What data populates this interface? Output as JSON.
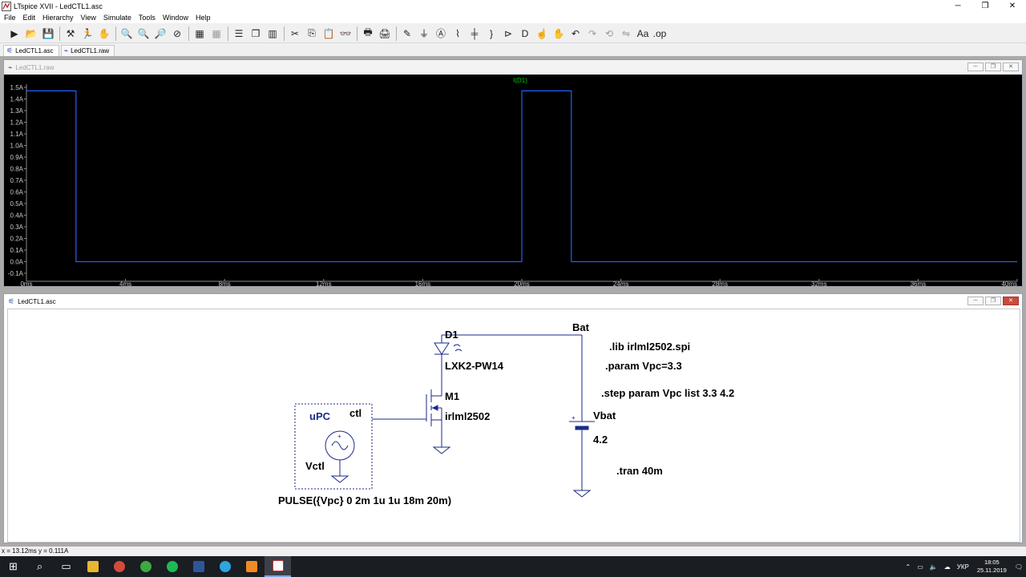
{
  "window": {
    "title": "LTspice XVII - LedCTL1.asc",
    "minimize_glyph": "─",
    "maximize_glyph": "❐",
    "close_glyph": "✕"
  },
  "menu": [
    "File",
    "Edit",
    "Hierarchy",
    "View",
    "Simulate",
    "Tools",
    "Window",
    "Help"
  ],
  "toolbar": {
    "icons": [
      "run-icon",
      "open-icon",
      "save-icon",
      "control-panel-icon",
      "run-halt-icon",
      "pan-icon",
      "zoom-in-icon",
      "zoom-area-icon",
      "zoom-out-icon",
      "zoom-cancel-icon",
      "autorange-icon",
      "clear-icon",
      "tile-horizontal-icon",
      "cascade-icon",
      "tile-vertical-icon",
      "cut-icon",
      "copy-icon",
      "paste-icon",
      "find-icon",
      "print-setup-icon",
      "print-icon",
      "draw-wire-icon",
      "ground-icon",
      "label-net-icon",
      "resistor-icon",
      "capacitor-icon",
      "inductor-icon",
      "diode-icon",
      "component-icon",
      "move-icon",
      "drag-icon",
      "undo-icon",
      "redo-icon",
      "rotate-icon",
      "mirror-icon",
      "text-icon",
      "spice-directive-icon"
    ]
  },
  "tabs": [
    {
      "label": "LedCTL1.asc",
      "icon": "schematic-icon"
    },
    {
      "label": "LedCTL1.raw",
      "icon": "waveform-icon"
    }
  ],
  "waveform_window": {
    "title": "LedCTL1.raw",
    "trace_name": "I(D1)",
    "trace_color": "#2060ff",
    "label_color": "#00cc00"
  },
  "chart_data": {
    "type": "line",
    "title": "I(D1)",
    "xlabel": "",
    "ylabel": "",
    "xlim": [
      0,
      40
    ],
    "ylim": [
      -0.1,
      1.5
    ],
    "x_ticks": [
      "0ms",
      "4ms",
      "8ms",
      "12ms",
      "16ms",
      "20ms",
      "24ms",
      "28ms",
      "32ms",
      "36ms",
      "40ms"
    ],
    "y_ticks": [
      "1.5A",
      "1.4A",
      "1.3A",
      "1.2A",
      "1.1A",
      "1.0A",
      "0.9A",
      "0.8A",
      "0.7A",
      "0.6A",
      "0.5A",
      "0.4A",
      "0.3A",
      "0.2A",
      "0.1A",
      "0.0A",
      "-0.1A"
    ],
    "series": [
      {
        "name": "I(D1)",
        "x": [
          0,
          2,
          2,
          20,
          20,
          22,
          22,
          40
        ],
        "values": [
          1.47,
          1.47,
          0.0,
          0.0,
          1.47,
          1.47,
          0.0,
          0.0
        ]
      }
    ],
    "grid": false
  },
  "schematic_window": {
    "title": "LedCTL1.asc",
    "labels": {
      "d1_name": "D1",
      "d1_value": "LXK2-PW14",
      "m1_name": "M1",
      "m1_value": "irlml2502",
      "bat_net": "Bat",
      "ctl_net": "ctl",
      "upc_label": "uPC",
      "vctl_name": "Vctl",
      "vctl_value": "PULSE({Vpc} 0 2m 1u 1u 18m 20m)",
      "vbat_name": "Vbat",
      "vbat_value": "4.2"
    },
    "directives": [
      ".lib irlml2502.spi",
      ".param Vpc=3.3",
      ".step param Vpc list 3.3 4.2",
      ".tran 40m"
    ]
  },
  "status_bar": {
    "text": "x = 13.12ms   y = 0.111A"
  },
  "taskbar": {
    "apps": [
      "windows-start-icon",
      "search-icon",
      "task-view-icon",
      "file-explorer-icon",
      "chrome-icon",
      "utorrent-icon",
      "spotify-icon",
      "word-icon",
      "telegram-icon",
      "sublime-icon",
      "ltspice-icon"
    ],
    "language": "УКР",
    "time": "18:05",
    "date": "25.11.2019",
    "tray_icons": [
      "chevron-up-icon",
      "network-icon",
      "volume-icon",
      "cloud-icon",
      "notification-icon"
    ]
  }
}
